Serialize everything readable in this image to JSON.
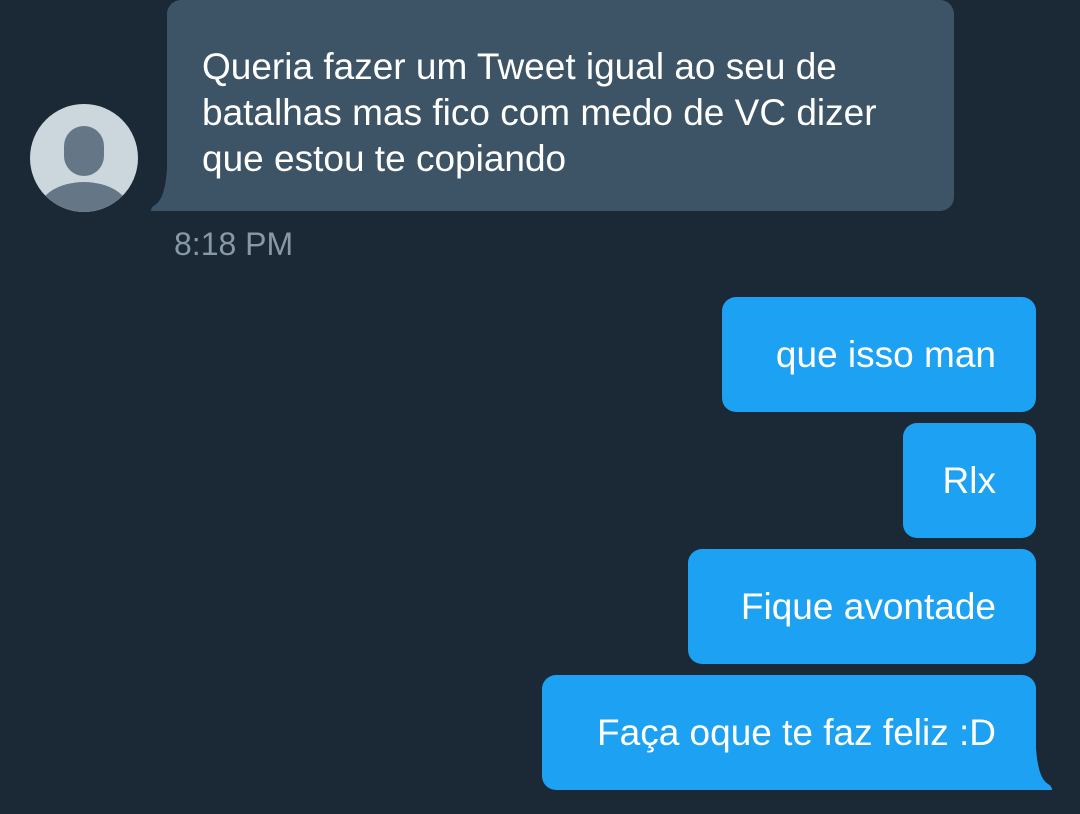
{
  "conversation": {
    "incoming": {
      "text": "Queria fazer um Tweet igual ao seu de\nbatalhas mas fico com medo de VC dizer\nque estou te copiando",
      "time": "8:18 PM"
    },
    "outgoing": [
      {
        "text": "que isso man"
      },
      {
        "text": "Rlx"
      },
      {
        "text": "Fique avontade"
      },
      {
        "text": "Faça oque te faz feliz :D"
      }
    ]
  },
  "avatar": {
    "icon": "default-profile-icon"
  },
  "colors": {
    "background": "#1b2836",
    "incoming_bubble": "#3d5466",
    "outgoing_bubble": "#1da1f2",
    "timestamp": "#8899a6",
    "text": "#ffffff"
  }
}
